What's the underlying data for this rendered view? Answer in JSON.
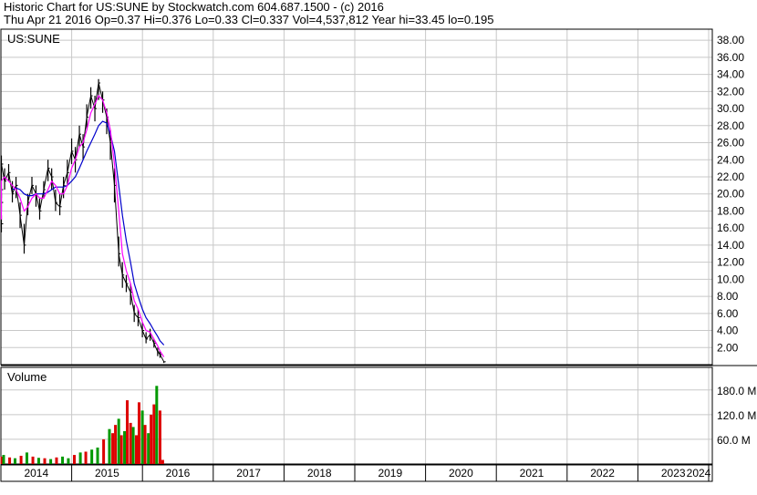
{
  "header": {
    "line1": "Historic Chart for US:SUNE by Stockwatch.com 604.687.1500 - (c) 2016",
    "line2": "Thu Apr 21 2016  Op=0.37  Hi=0.376  Lo=0.33  Cl=0.337  Vol=4,537,812  Year hi=33.45  lo=0.195"
  },
  "chart_data": {
    "type": "line",
    "symbol_label": "US:SUNE",
    "volume_label": "Volume",
    "colors": {
      "price": "#000000",
      "ma_short": "#ff00ff",
      "ma_long": "#0000cc",
      "vol_up": "#009900",
      "vol_down": "#dd0000",
      "grid": "#c8c8c8"
    },
    "years": [
      "2014",
      "2015",
      "2016",
      "2017",
      "2018",
      "2019",
      "2020",
      "2021",
      "2022",
      "2023",
      "2024"
    ],
    "price_axis": {
      "ticks": [
        2,
        4,
        6,
        8,
        10,
        12,
        14,
        16,
        18,
        20,
        22,
        24,
        26,
        28,
        30,
        32,
        34,
        36,
        38
      ],
      "tick_labels": [
        "2.00",
        "4.00",
        "6.00",
        "8.00",
        "10.00",
        "12.00",
        "14.00",
        "16.00",
        "18.00",
        "20.00",
        "22.00",
        "24.00",
        "26.00",
        "28.00",
        "30.00",
        "32.00",
        "34.00",
        "36.00",
        "38.00"
      ],
      "range": [
        0,
        39.3
      ]
    },
    "volume_axis": {
      "ticks": [
        60,
        120,
        180
      ],
      "tick_labels": [
        "60.0 M",
        "120.0 M",
        "180.0 M"
      ],
      "range": [
        0,
        235
      ]
    },
    "price": {
      "x": [
        "2013-11-01",
        "2013-11-20",
        "2013-12-10",
        "2014-01-01",
        "2014-01-20",
        "2014-02-10",
        "2014-03-01",
        "2014-03-20",
        "2014-04-10",
        "2014-05-01",
        "2014-05-20",
        "2014-06-10",
        "2014-07-01",
        "2014-07-20",
        "2014-08-10",
        "2014-09-01",
        "2014-09-20",
        "2014-10-10",
        "2014-11-01",
        "2014-11-20",
        "2014-12-10",
        "2015-01-01",
        "2015-01-20",
        "2015-02-10",
        "2015-03-01",
        "2015-03-20",
        "2015-04-10",
        "2015-05-01",
        "2015-05-20",
        "2015-06-10",
        "2015-07-01",
        "2015-07-20",
        "2015-08-10",
        "2015-09-01",
        "2015-09-20",
        "2015-10-10",
        "2015-11-01",
        "2015-11-20",
        "2015-12-10",
        "2016-01-01",
        "2016-01-20",
        "2016-02-10",
        "2016-03-01",
        "2016-03-20",
        "2016-04-01",
        "2016-04-21"
      ],
      "close": [
        16.5,
        19.0,
        20.5,
        23.5,
        21.5,
        22.5,
        20.0,
        21.0,
        17.5,
        14.0,
        19.0,
        21.0,
        20.0,
        18.0,
        20.5,
        23.0,
        22.0,
        19.0,
        18.5,
        21.0,
        22.5,
        25.0,
        24.0,
        27.0,
        25.5,
        29.0,
        31.5,
        30.0,
        33.0,
        31.0,
        29.0,
        26.0,
        21.0,
        13.0,
        10.5,
        9.5,
        8.5,
        6.0,
        5.5,
        4.0,
        3.0,
        3.5,
        2.5,
        1.5,
        1.2,
        0.337
      ],
      "high": [
        17.5,
        20.0,
        21.5,
        24.5,
        23.0,
        23.5,
        21.5,
        22.0,
        19.0,
        16.5,
        20.0,
        22.0,
        21.0,
        19.5,
        21.5,
        24.0,
        23.0,
        20.5,
        20.0,
        22.0,
        24.0,
        26.5,
        25.5,
        28.0,
        27.0,
        30.5,
        32.5,
        31.5,
        33.45,
        32.0,
        30.0,
        27.5,
        23.0,
        15.0,
        12.0,
        10.5,
        9.5,
        7.0,
        6.5,
        5.0,
        3.8,
        4.2,
        3.0,
        2.0,
        1.5,
        0.376
      ],
      "low": [
        15.5,
        18.0,
        19.5,
        22.0,
        20.5,
        21.5,
        19.0,
        19.5,
        16.0,
        13.0,
        17.5,
        20.0,
        18.5,
        17.0,
        19.5,
        21.5,
        20.5,
        18.0,
        17.5,
        19.5,
        21.0,
        23.5,
        22.5,
        25.5,
        24.0,
        27.5,
        30.0,
        28.5,
        31.0,
        29.5,
        27.0,
        24.0,
        19.0,
        11.5,
        9.0,
        8.5,
        7.0,
        5.0,
        4.5,
        3.2,
        2.5,
        2.8,
        2.0,
        1.0,
        0.8,
        0.195
      ],
      "ma_short": [
        17.0,
        18.5,
        20.0,
        21.5,
        22.0,
        21.5,
        21.0,
        20.5,
        19.5,
        18.0,
        18.5,
        19.5,
        20.0,
        19.5,
        19.5,
        20.5,
        21.5,
        21.0,
        20.0,
        20.0,
        21.0,
        23.0,
        24.0,
        25.5,
        26.0,
        27.5,
        29.5,
        30.5,
        31.5,
        31.0,
        29.5,
        27.5,
        23.5,
        18.0,
        13.0,
        11.0,
        9.5,
        7.5,
        6.5,
        5.0,
        4.0,
        3.8,
        3.0,
        2.2,
        1.6,
        0.9
      ],
      "ma_long": [
        null,
        null,
        null,
        null,
        null,
        null,
        20.5,
        20.7,
        20.5,
        20.0,
        19.8,
        19.8,
        20.0,
        20.0,
        20.0,
        20.2,
        20.5,
        20.8,
        20.8,
        20.8,
        21.0,
        21.5,
        22.0,
        23.0,
        24.0,
        25.0,
        26.0,
        27.0,
        28.0,
        28.5,
        28.3,
        27.0,
        25.0,
        21.0,
        17.5,
        14.5,
        12.0,
        9.5,
        8.0,
        6.5,
        5.5,
        4.8,
        4.0,
        3.3,
        2.8,
        2.3
      ]
    },
    "volume": {
      "x": [
        "2013-11-15",
        "2013-12-15",
        "2014-01-15",
        "2014-02-15",
        "2014-03-15",
        "2014-04-15",
        "2014-05-15",
        "2014-06-15",
        "2014-07-15",
        "2014-08-15",
        "2014-09-15",
        "2014-10-15",
        "2014-11-15",
        "2014-12-15",
        "2015-01-15",
        "2015-02-15",
        "2015-03-15",
        "2015-04-15",
        "2015-05-15",
        "2015-06-15",
        "2015-07-15",
        "2015-08-01",
        "2015-08-15",
        "2015-09-01",
        "2015-09-15",
        "2015-10-01",
        "2015-10-15",
        "2015-11-01",
        "2015-11-15",
        "2015-12-01",
        "2015-12-15",
        "2016-01-01",
        "2016-01-15",
        "2016-02-01",
        "2016-02-15",
        "2016-03-01",
        "2016-03-15",
        "2016-04-01",
        "2016-04-15"
      ],
      "values": [
        12,
        18,
        22,
        16,
        14,
        20,
        28,
        18,
        15,
        14,
        12,
        16,
        18,
        14,
        22,
        28,
        30,
        35,
        40,
        60,
        85,
        75,
        95,
        110,
        70,
        80,
        155,
        100,
        90,
        70,
        150,
        130,
        95,
        75,
        120,
        145,
        190,
        130,
        10
      ],
      "up": [
        true,
        false,
        true,
        false,
        true,
        false,
        true,
        false,
        true,
        false,
        true,
        false,
        true,
        true,
        false,
        true,
        false,
        true,
        true,
        false,
        true,
        false,
        false,
        true,
        false,
        true,
        false,
        false,
        true,
        false,
        false,
        true,
        false,
        true,
        false,
        false,
        true,
        false,
        false
      ]
    }
  }
}
